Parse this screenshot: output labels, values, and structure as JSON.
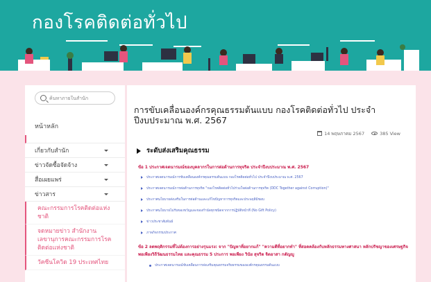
{
  "banner": {
    "title": "กองโรคติดต่อทั่วไป"
  },
  "sidebar": {
    "search_placeholder": "ค้นหาภายในสำนัก",
    "home_label": "หน้าหลัก",
    "nav_items": [
      {
        "label": "เกี่ยวกับสำนัก"
      },
      {
        "label": "ข่าวจัดซื้อจัดจ้าง"
      },
      {
        "label": "สื่อเผยแพร่"
      },
      {
        "label": "ข่าวสาร"
      }
    ],
    "sub_items": [
      {
        "label": "คณะกรรมการโรคติดต่อแห่งชาติ"
      },
      {
        "label": "จดหมายข่าว สำนักงานเลขานุการคณะกรรมการโรคติดต่อแห่งชาติ"
      },
      {
        "label": "วัคซีนโควิด 19 ประเทศไทย"
      }
    ]
  },
  "article": {
    "title": "การขับเคลื่อนองค์กรคุณธรรมต้นแบบ กองโรคติดต่อทั่วไป ประจำปีงบประมาณ พ.ศ. 2567",
    "date": "14 พฤษภาคม 2567",
    "views": "385 View",
    "section_heading": "ระดับส่งเสริมคุณธรรม",
    "point_1": "ข้อ 1 ประกาศเจตนารมณ์ของบุคลากรในการต่อต้านการทุจริต ประจำปีงบประมาณ พ.ศ. 2567",
    "links": [
      {
        "label": "ประกาศเจตนารมณ์การขับเคลื่อนองค์กรคุณธรรมต้นแบบ กองโรคติดต่อทั่วไป ประจำปีงบประมาณ พ.ศ. 2567"
      },
      {
        "label": "ประกาศเจตนารมณ์การต่อต้านการทุจริต \"กองโรคติดต่อทั่วไปร่วมใจต่อต้านการทุจริต (DDC Together against Corruption)\""
      },
      {
        "label": "ประกาศนโยบายส่งเสริมในการต่อต้านและแก้ไขปัญหาการทุจริตและประพฤติมิชอบ"
      },
      {
        "label": "ประกาศนโยบายไม่รับของขวัญและของกำนัลทุกชนิดจากการปฏิบัติหน้าที่ (No Gift Policy)"
      },
      {
        "label": "ข่าวประชาสัมพันธ์"
      },
      {
        "label": "ภาพกิจกรรมประกาศ"
      }
    ],
    "point_2": "ข้อ 2 ลดพฤติกรรมที่ไม่ต้องการอย่างรุนแรง: จาก \"ปัญหาที่อยากแก้\" \"ความดีที่อยากทำ\" ที่สอดคล้องกับหลักธรรมทางศาสนา หลักปรัชญาของเศรษฐกิจพอเพียงวิถีวัฒนธรรมไทย และคุณธรรม 5 ประการ พอเพียง วินัย สุจริต จิตอาสา กตัญญู",
    "sub_point": "ประกาศเจตนารมณ์ขับเคลื่อนการส่งเสริมคุณธรรมจริยธรรมขององค์กรคุณธรรมต้นแบบ"
  },
  "colors": {
    "banner": "#1da7a0",
    "accent": "#e4557d",
    "point_red": "#c9184a",
    "link_blue": "#4a62c4",
    "page_bg": "#fbe3e9"
  }
}
